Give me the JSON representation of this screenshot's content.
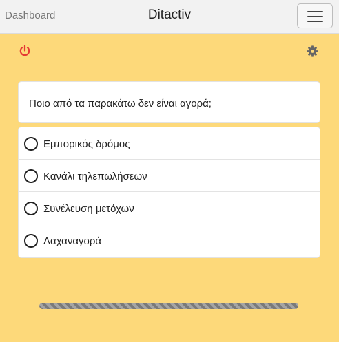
{
  "navbar": {
    "brand": "Dashboard",
    "title": "Ditactiv",
    "menu_icon": "hamburger-icon"
  },
  "toolbar": {
    "logout_icon": "power-icon",
    "logout_color": "#e53935",
    "settings_icon": "gear-icon",
    "settings_color": "#666666"
  },
  "quiz": {
    "question": "Ποιο από τα παρακάτω δεν είναι αγορά;",
    "answers": [
      {
        "label": "Εμπορικός δρόμος",
        "selected": false
      },
      {
        "label": "Κανάλι τηλεπωλήσεων",
        "selected": false
      },
      {
        "label": "Συνέλευση μετόχων",
        "selected": false
      },
      {
        "label": "Λαχαναγορά",
        "selected": false
      }
    ]
  },
  "progress": {
    "value": 1.0,
    "style": "striped"
  },
  "colors": {
    "background": "#fdd97a",
    "navbar": "#f2f2f2"
  }
}
